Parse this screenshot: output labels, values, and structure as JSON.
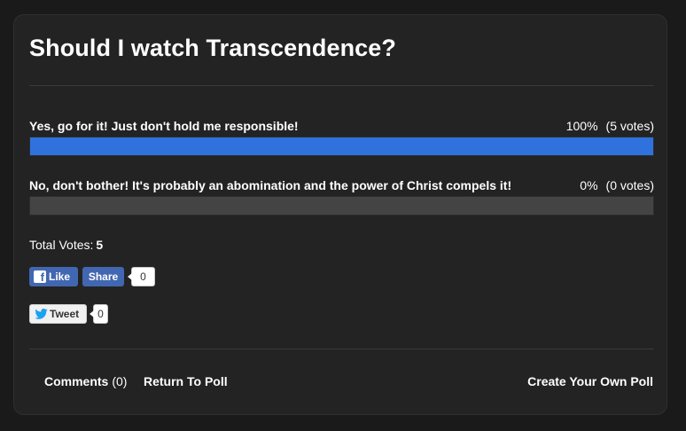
{
  "poll": {
    "title": "Should I watch Transcendence?",
    "options": [
      {
        "label": "Yes, go for it! Just don't hold me responsible!",
        "percent_text": "100%",
        "votes_text": "(5 votes)",
        "fraction": 1.0
      },
      {
        "label": "No, don't bother! It's probably an abomination and the power of Christ compels it!",
        "percent_text": "0%",
        "votes_text": "(0 votes)",
        "fraction": 0.0
      }
    ],
    "total_label": "Total Votes:",
    "total_value": "5"
  },
  "social": {
    "facebook": {
      "icon": "facebook-icon",
      "like_label": "Like",
      "share_label": "Share",
      "count": "0"
    },
    "twitter": {
      "icon": "twitter-bird-icon",
      "tweet_label": "Tweet",
      "count": "0"
    }
  },
  "footer": {
    "comments_label": "Comments",
    "comments_count": "(0)",
    "return_label": "Return To Poll",
    "create_label": "Create Your Own Poll"
  },
  "colors": {
    "page_background": "#1a1a1a",
    "card_background": "#232323",
    "bar_fill": "#2f72dd",
    "bar_track": "#444444",
    "facebook_blue": "#4267b2",
    "twitter_blue": "#1da1f2"
  }
}
